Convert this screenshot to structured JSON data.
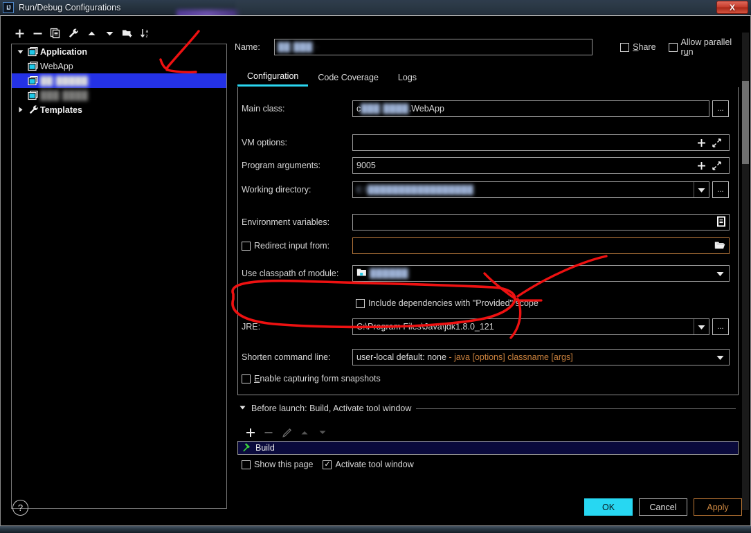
{
  "window": {
    "title": "Run/Debug Configurations",
    "app_icon": "intellij-idea-icon",
    "close_label": "X"
  },
  "sidebar": {
    "toolbar": [
      {
        "name": "add-configuration-button",
        "icon": "plus-icon",
        "label": "+"
      },
      {
        "name": "remove-configuration-button",
        "icon": "minus-icon",
        "label": "−"
      },
      {
        "name": "copy-configuration-button",
        "icon": "copy-icon",
        "label": "copy"
      },
      {
        "name": "edit-templates-button",
        "icon": "wrench-icon",
        "label": "wrench"
      },
      {
        "name": "move-up-button",
        "icon": "arrow-up-icon",
        "label": "up"
      },
      {
        "name": "move-down-button",
        "icon": "arrow-down-icon",
        "label": "down"
      },
      {
        "name": "new-folder-button",
        "icon": "folder-add-icon",
        "label": "folder+"
      },
      {
        "name": "sort-alphabetically-button",
        "icon": "sort-az-icon",
        "label": "sort"
      }
    ],
    "tree": [
      {
        "label": "Application",
        "icon": "application-group-icon",
        "bold": true,
        "expanded": true,
        "selected": false,
        "indent": 0,
        "redacted": false
      },
      {
        "label": "WebApp",
        "icon": "run-configuration-icon",
        "bold": false,
        "expanded": null,
        "selected": false,
        "indent": 1,
        "redacted": false
      },
      {
        "label": "██ █████",
        "icon": "run-configuration-icon",
        "bold": false,
        "expanded": null,
        "selected": true,
        "indent": 1,
        "redacted": true
      },
      {
        "label": "███ ████",
        "icon": "run-configuration-icon",
        "bold": false,
        "expanded": null,
        "selected": false,
        "indent": 1,
        "redacted": true
      },
      {
        "label": "Templates",
        "icon": "wrench-icon",
        "bold": true,
        "expanded": false,
        "selected": false,
        "indent": 0,
        "redacted": false
      }
    ]
  },
  "main": {
    "name": {
      "label": "Name:",
      "value": "██ ███ ·",
      "redacted": true
    },
    "share": {
      "label": "Share",
      "checked": false
    },
    "allow_parallel_run": {
      "label": "Allow parallel run",
      "checked": false
    },
    "tabs": [
      {
        "label": "Configuration",
        "active": true
      },
      {
        "label": "Code Coverage",
        "active": false
      },
      {
        "label": "Logs",
        "active": false
      }
    ],
    "fields": {
      "main_class": {
        "label": "Main class:",
        "value": "c███ ████.WebApp",
        "browse_label": "...",
        "redacted": true
      },
      "vm_options": {
        "label": "VM options:",
        "value": "",
        "placeholder": "",
        "insert_macro_label": "+",
        "expand_label": "expand"
      },
      "program_arguments": {
        "label": "Program arguments:",
        "value": "9005",
        "insert_macro_label": "+",
        "expand_label": "expand"
      },
      "working_directory": {
        "label": "Working directory:",
        "value": "E:\\█████████████████",
        "browse_label": "...",
        "redacted": true
      },
      "environment_variables": {
        "label": "Environment variables:",
        "value": "",
        "editor_icon": "env-editor-icon"
      },
      "redirect_input_from": {
        "label": "Redirect input from:",
        "checked": false,
        "value": "",
        "browse_icon": "folder-open-icon",
        "border_color": "#b5763a"
      },
      "use_classpath_of_module": {
        "label": "Use classpath of module:",
        "value": "██████",
        "icon": "module-icon",
        "redacted": true
      },
      "include_provided_scope": {
        "label": "Include dependencies with \"Provided\" scope",
        "checked": false
      },
      "jre": {
        "label": "JRE:",
        "value": "C:\\Program Files\\Java\\jdk1.8.0_121",
        "browse_label": "..."
      },
      "shorten_command_line": {
        "label": "Shorten command line:",
        "value_main": "user-local default: none",
        "value_suffix": "- java [options] classname [args]",
        "suffix_color": "#c9803d"
      },
      "enable_capturing_form_snapshots": {
        "label": "Enable capturing form snapshots",
        "label_accel": "E",
        "checked": false
      }
    },
    "before_launch": {
      "title": "Before launch: Build, Activate tool window",
      "toolbar": [
        {
          "name": "add-task-button",
          "icon": "plus-icon",
          "label": "+",
          "enabled": true
        },
        {
          "name": "remove-task-button",
          "icon": "minus-icon",
          "label": "−",
          "enabled": false
        },
        {
          "name": "edit-task-button",
          "icon": "pencil-icon",
          "label": "edit",
          "enabled": false
        },
        {
          "name": "move-task-up-button",
          "icon": "arrow-up-icon",
          "label": "up",
          "enabled": false
        },
        {
          "name": "move-task-down-button",
          "icon": "arrow-down-icon",
          "label": "down",
          "enabled": false
        }
      ],
      "tasks": [
        {
          "label": "Build",
          "icon": "hammer-icon",
          "selected": true
        }
      ],
      "show_this_page": {
        "label": "Show this page",
        "checked": false
      },
      "activate_tool_window": {
        "label": "Activate tool window",
        "checked": true
      }
    }
  },
  "footer": {
    "help_label": "?",
    "buttons": [
      {
        "name": "ok-button",
        "label": "OK",
        "style": "primary"
      },
      {
        "name": "cancel-button",
        "label": "Cancel",
        "style": "default"
      },
      {
        "name": "apply-button",
        "label": "Apply",
        "style": "apply"
      }
    ]
  },
  "annotations": {
    "color": "#ee1111",
    "marks": [
      {
        "name": "sidebar-arrow-annotation",
        "shape": "arrow"
      },
      {
        "name": "jre-ellipse-annotation",
        "shape": "ellipse"
      },
      {
        "name": "jre-pointer-annotation",
        "shape": "arrow"
      }
    ]
  },
  "colors": {
    "accent_tab": "#2ad6f0",
    "selection": "#2432e6",
    "ok_button": "#27d7f2",
    "apply_border": "#c07a36",
    "warning_border": "#b5763a",
    "annotation_red": "#ee1111",
    "list_selection": "#0a0a3c"
  }
}
